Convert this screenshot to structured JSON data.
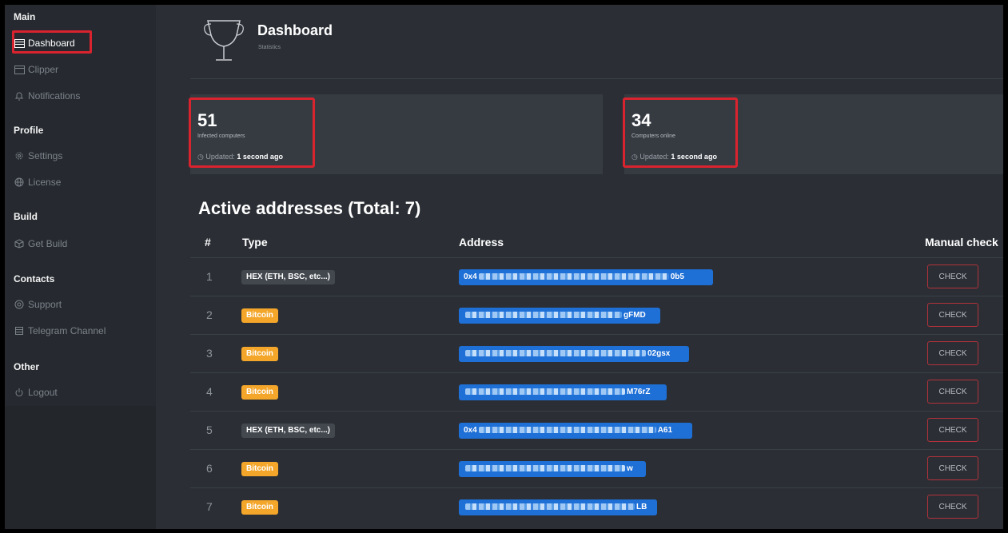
{
  "sidebar": {
    "sections": [
      "Main",
      "Profile",
      "Build",
      "Contacts",
      "Other"
    ],
    "items": [
      {
        "label": "Dashboard",
        "icon": "dashboard-icon"
      },
      {
        "label": "Clipper",
        "icon": "clipboard-icon"
      },
      {
        "label": "Notifications",
        "icon": "bell-icon"
      },
      {
        "label": "Settings",
        "icon": "gear-icon"
      },
      {
        "label": "License",
        "icon": "globe-icon"
      },
      {
        "label": "Get Build",
        "icon": "box-icon"
      },
      {
        "label": "Support",
        "icon": "support-icon"
      },
      {
        "label": "Telegram Channel",
        "icon": "building-icon"
      },
      {
        "label": "Logout",
        "icon": "power-icon"
      }
    ]
  },
  "header": {
    "title": "Dashboard",
    "subtitle": "Statistics",
    "icon": "trophy-icon"
  },
  "stats": [
    {
      "value": "51",
      "label": "Infected computers",
      "updated_prefix": "Updated:",
      "updated_value": "1 second ago"
    },
    {
      "value": "34",
      "label": "Computers online",
      "updated_prefix": "Updated:",
      "updated_value": "1 second ago"
    }
  ],
  "table": {
    "title": "Active addresses (Total: 7)",
    "headers": {
      "index": "#",
      "type": "Type",
      "address": "Address",
      "manual": "Manual check"
    },
    "check_label": "CHECK",
    "rows": [
      {
        "index": "1",
        "type": "HEX (ETH, BSC, etc...)",
        "kind": "hex",
        "addr_start": "0x4",
        "addr_end": "0b5"
      },
      {
        "index": "2",
        "type": "Bitcoin",
        "kind": "btc",
        "addr_start": "",
        "addr_end": "gFMD"
      },
      {
        "index": "3",
        "type": "Bitcoin",
        "kind": "btc",
        "addr_start": "",
        "addr_end": "02gsx"
      },
      {
        "index": "4",
        "type": "Bitcoin",
        "kind": "btc",
        "addr_start": "",
        "addr_end": "M76rZ"
      },
      {
        "index": "5",
        "type": "HEX (ETH, BSC, etc...)",
        "kind": "hex",
        "addr_start": "0x4",
        "addr_end": "A61"
      },
      {
        "index": "6",
        "type": "Bitcoin",
        "kind": "btc",
        "addr_start": "",
        "addr_end": "w"
      },
      {
        "index": "7",
        "type": "Bitcoin",
        "kind": "btc",
        "addr_start": "",
        "addr_end": "LB"
      }
    ]
  },
  "colors": {
    "accent_red": "#d9232e",
    "bitcoin": "#f4a62a",
    "address_blue": "#1e6fd6"
  }
}
